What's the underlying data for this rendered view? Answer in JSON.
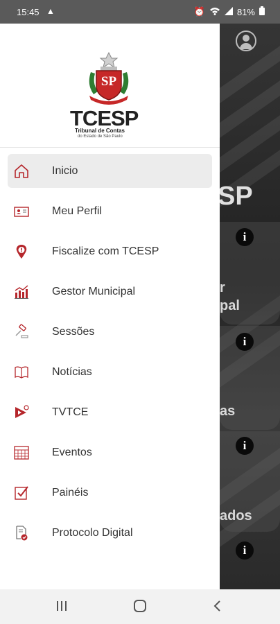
{
  "status_bar": {
    "time": "15:45",
    "battery": "81%",
    "icons": [
      "warning-icon",
      "alarm-icon",
      "wifi-icon",
      "signal-icon",
      "battery-icon"
    ]
  },
  "drawer": {
    "logo": {
      "brand": "TCESP",
      "subtitle": "Tribunal de Contas",
      "subtitle_small": "do Estado de São Paulo"
    },
    "menu": [
      {
        "label": "Inicio",
        "icon": "home-icon",
        "active": true
      },
      {
        "label": "Meu Perfil",
        "icon": "profile-card-icon"
      },
      {
        "label": "Fiscalize com TCESP",
        "icon": "location-alert-icon"
      },
      {
        "label": "Gestor Municipal",
        "icon": "bar-chart-icon"
      },
      {
        "label": "Sessões",
        "icon": "gavel-icon"
      },
      {
        "label": "Notícias",
        "icon": "book-icon"
      },
      {
        "label": "TVTCE",
        "icon": "video-play-icon"
      },
      {
        "label": "Eventos",
        "icon": "calendar-grid-icon"
      },
      {
        "label": "Painéis",
        "icon": "checkbox-icon"
      },
      {
        "label": "Protocolo Digital",
        "icon": "digital-document-icon"
      }
    ]
  },
  "background": {
    "texts": [
      "SP",
      "r",
      "pal",
      "as",
      "ados"
    ]
  },
  "colors": {
    "accent": "#b5262b",
    "drawer_bg": "#ffffff",
    "active_bg": "#ececec"
  }
}
